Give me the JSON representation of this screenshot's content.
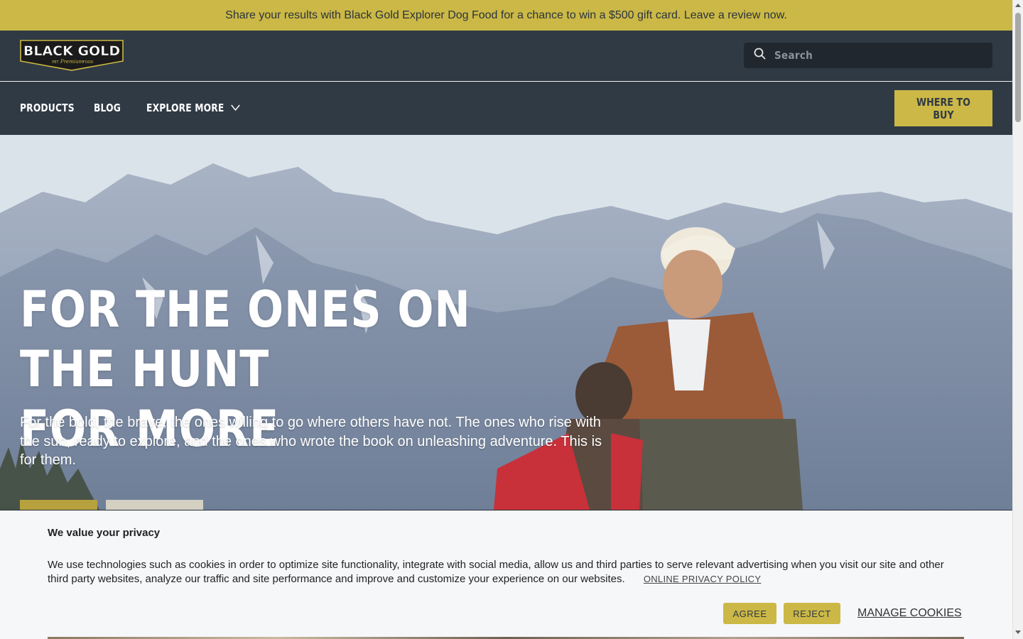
{
  "promo": {
    "text": "Share your results with Black Gold Explorer Dog Food for a chance to win a $500 gift card. Leave a review now."
  },
  "header": {
    "logo_text": "BLACK GOLD",
    "logo_tagline_left": "PET",
    "logo_tagline_mid": "Premium",
    "logo_tagline_right": "FOOD",
    "search_placeholder": "Search"
  },
  "nav": {
    "items": [
      {
        "label": "Products"
      },
      {
        "label": "Blog"
      },
      {
        "label": "Explore More"
      }
    ],
    "cta_label": "Where to Buy"
  },
  "hero": {
    "title_line1": "For the ones on the hunt",
    "title_line2": "for more",
    "subtitle": "For the bold, the brave, the ones willing to go where others have not. The ones who rise with the sun, ready to explore, and the ones who wrote the book on unleashing adventure. This is for them."
  },
  "cookie": {
    "title": "We value your privacy",
    "body": "We use technologies such as cookies in order to optimize site functionality, integrate with social media, allow us and third parties to serve relevant advertising when you visit our site and other third party websites, analyze our traffic and site performance and improve and customize your experience on our websites.",
    "policy_link": "ONLINE PRIVACY POLICY",
    "agree_label": "AGREE",
    "reject_label": "REJECT",
    "manage_label": "MANAGE COOKIES"
  },
  "colors": {
    "brand_gold": "#cbb846",
    "brand_dark": "#303a44"
  }
}
